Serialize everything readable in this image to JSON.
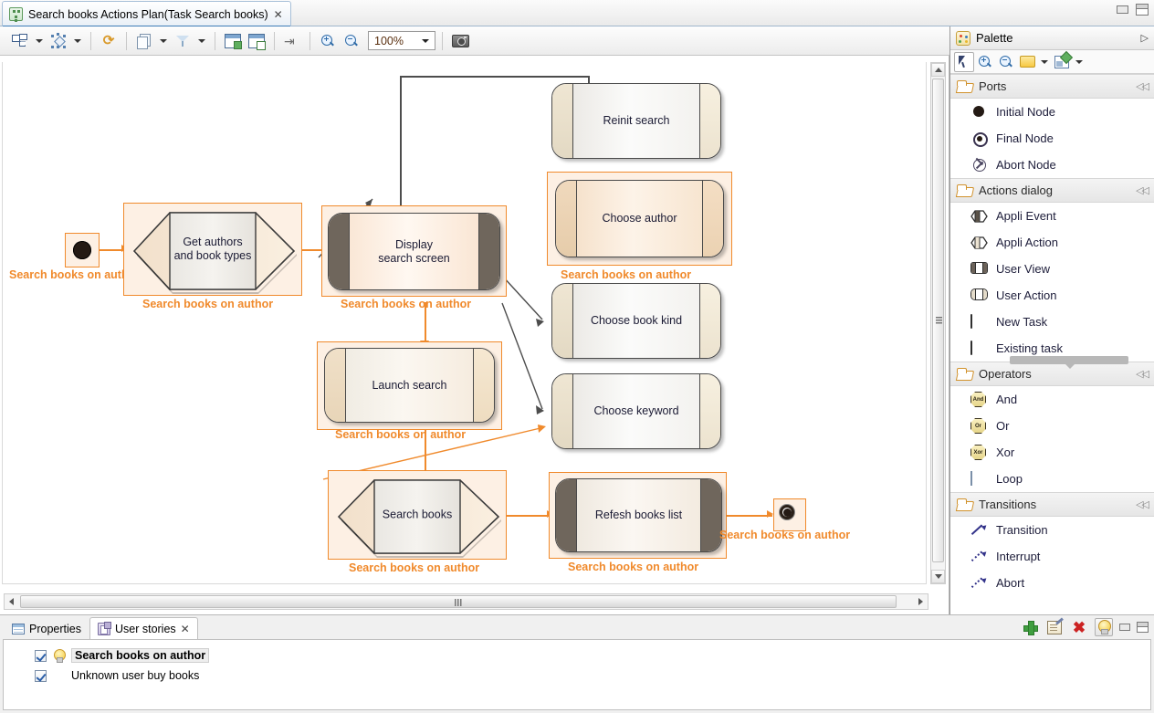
{
  "window": {
    "tab_title": "Search books Actions Plan(Task Search books)",
    "tab_close": "✕",
    "minimize": "minimize",
    "maximize": "maximize"
  },
  "toolbar": {
    "zoom_value": "100%",
    "buttons": [
      {
        "name": "arrange-all",
        "label": "Arrange All"
      },
      {
        "name": "select-nodes",
        "label": "Select"
      },
      {
        "name": "refresh",
        "label": "Refresh"
      },
      {
        "name": "copy-appearance",
        "label": "Copy Appearance"
      },
      {
        "name": "filters",
        "label": "Filters"
      },
      {
        "name": "show-hide",
        "label": "Show/Hide"
      },
      {
        "name": "validate",
        "label": "Validate"
      },
      {
        "name": "pin",
        "label": "Pin Elements"
      },
      {
        "name": "zoom-in",
        "label": "Zoom In"
      },
      {
        "name": "zoom-out",
        "label": "Zoom Out"
      },
      {
        "name": "snapshot",
        "label": "Export as image"
      }
    ]
  },
  "diagram": {
    "selection_label": "Search books on author",
    "nodes": [
      {
        "id": "initial",
        "type": "initial-node",
        "label": "",
        "selected": true
      },
      {
        "id": "get-authors",
        "type": "appli-event",
        "label": "Get authors\nand book types",
        "selected": true
      },
      {
        "id": "display-search-screen",
        "type": "user-view",
        "label": "Display\nsearch screen",
        "selected": true
      },
      {
        "id": "reinit-search",
        "type": "user-action",
        "label": "Reinit search",
        "selected": false
      },
      {
        "id": "choose-author",
        "type": "user-action",
        "label": "Choose author",
        "selected": true
      },
      {
        "id": "choose-book-kind",
        "type": "user-action",
        "label": "Choose book kind",
        "selected": false
      },
      {
        "id": "choose-keyword",
        "type": "user-action",
        "label": "Choose keyword",
        "selected": false
      },
      {
        "id": "launch-search",
        "type": "user-action",
        "label": "Launch search",
        "selected": true
      },
      {
        "id": "search-books",
        "type": "appli-event",
        "label": "Search books",
        "selected": true
      },
      {
        "id": "refesh-books-list",
        "type": "user-view",
        "label": "Refesh books list",
        "selected": true
      },
      {
        "id": "final",
        "type": "final-node",
        "label": "",
        "selected": true
      }
    ],
    "colors": {
      "selection": "#f08a2c",
      "selection_fill": "#fdf0e4",
      "connection": "#4d4d4d"
    }
  },
  "palette": {
    "title": "Palette",
    "expand_glyph": "▷",
    "collapse_glyph": "◁◁",
    "tools": [
      {
        "name": "select-tool",
        "label": "Select"
      },
      {
        "name": "zoom-in-tool",
        "label": "Zoom In"
      },
      {
        "name": "zoom-out-tool",
        "label": "Zoom Out"
      },
      {
        "name": "note-tool",
        "label": "Note"
      },
      {
        "name": "note-attachment-tool",
        "label": "Note Attachment"
      }
    ],
    "groups": [
      {
        "name": "ports",
        "title": "Ports",
        "items": [
          {
            "name": "initial-node",
            "label": "Initial Node",
            "icon": "initial-node-icon"
          },
          {
            "name": "final-node",
            "label": "Final Node",
            "icon": "final-node-icon"
          },
          {
            "name": "abort-node",
            "label": "Abort Node",
            "icon": "abort-node-icon"
          }
        ]
      },
      {
        "name": "actions-dialog",
        "title": "Actions dialog",
        "items": [
          {
            "name": "appli-event",
            "label": "Appli Event",
            "icon": "appli-event-icon"
          },
          {
            "name": "appli-action",
            "label": "Appli Action",
            "icon": "appli-action-icon"
          },
          {
            "name": "user-view",
            "label": "User View",
            "icon": "user-view-icon"
          },
          {
            "name": "user-action",
            "label": "User Action",
            "icon": "user-action-icon"
          },
          {
            "name": "new-task",
            "label": "New Task",
            "icon": "new-task-icon"
          },
          {
            "name": "existing-task",
            "label": "Existing task",
            "icon": "existing-task-icon"
          }
        ]
      },
      {
        "name": "operators",
        "title": "Operators",
        "items": [
          {
            "name": "and",
            "label": "And",
            "icon": "and-icon",
            "glyph": "And"
          },
          {
            "name": "or",
            "label": "Or",
            "icon": "or-icon",
            "glyph": "Or"
          },
          {
            "name": "xor",
            "label": "Xor",
            "icon": "xor-icon",
            "glyph": "Xor"
          },
          {
            "name": "loop",
            "label": "Loop",
            "icon": "loop-icon",
            "glyph": ""
          }
        ]
      },
      {
        "name": "transitions",
        "title": "Transitions",
        "items": [
          {
            "name": "transition",
            "label": "Transition",
            "icon": "transition-arrow-icon"
          },
          {
            "name": "interrupt",
            "label": "Interrupt",
            "icon": "interrupt-arrow-icon"
          },
          {
            "name": "abort",
            "label": "Abort",
            "icon": "abort-arrow-icon"
          }
        ]
      }
    ]
  },
  "bottom_panel": {
    "tabs": [
      {
        "name": "properties",
        "label": "Properties",
        "active": false
      },
      {
        "name": "user-stories",
        "label": "User stories",
        "active": true,
        "close": "✕"
      }
    ],
    "toolbar": [
      {
        "name": "add-story-button",
        "label": "Add"
      },
      {
        "name": "edit-story-button",
        "label": "Edit"
      },
      {
        "name": "delete-story-button",
        "label": "Delete"
      },
      {
        "name": "highlight-story-button",
        "label": "Highlight"
      },
      {
        "name": "minimize-panel-button",
        "label": "Minimize"
      },
      {
        "name": "maximize-panel-button",
        "label": "Maximize"
      }
    ],
    "stories": [
      {
        "label": "Search books on author",
        "checked": true,
        "selected": true,
        "has_bulb": true
      },
      {
        "label": "Unknown user buy books",
        "checked": true,
        "selected": false,
        "has_bulb": false
      }
    ]
  }
}
